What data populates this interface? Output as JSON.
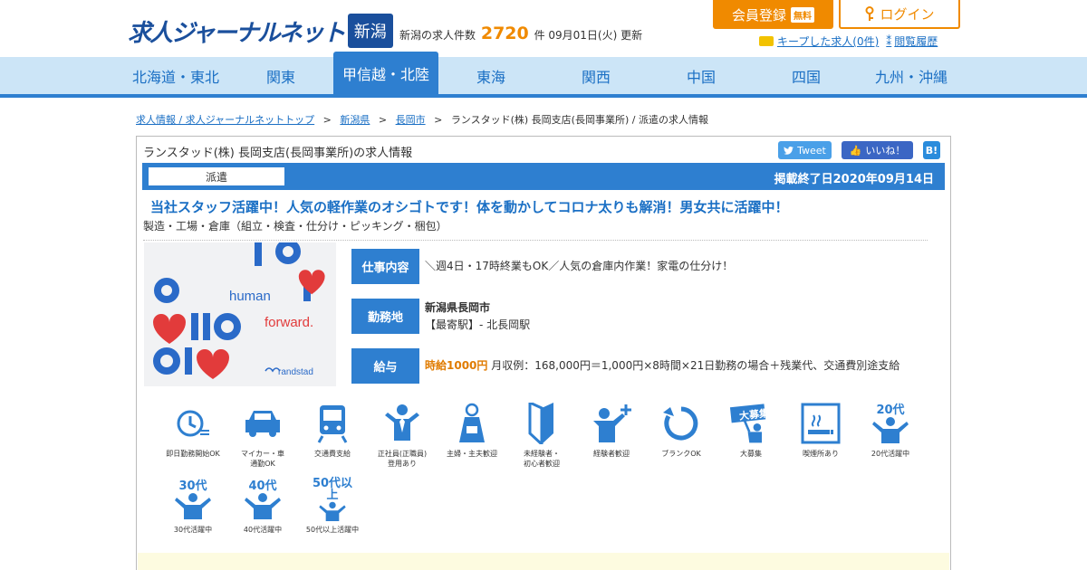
{
  "header": {
    "logo_text": "求人ジャーナルネット",
    "region_badge": "新潟",
    "count_prefix": "新潟の求人件数",
    "count_value": "2720",
    "count_suffix": "件 09月01日(火) 更新",
    "register_label": "会員登録",
    "register_badge": "無料",
    "login_label": "ログイン",
    "kept_jobs_label": "キープした求人(0件)",
    "history_label": "閲覧履歴"
  },
  "nav": {
    "items": [
      {
        "label": "北海道・東北"
      },
      {
        "label": "関東"
      },
      {
        "label": "甲信越・北陸"
      },
      {
        "label": "東海"
      },
      {
        "label": "関西"
      },
      {
        "label": "中国"
      },
      {
        "label": "四国"
      },
      {
        "label": "九州・沖縄"
      }
    ],
    "active": "甲信越・北陸"
  },
  "breadcrumb": {
    "items": [
      {
        "label": "求人情報 / 求人ジャーナルネットトップ"
      },
      {
        "label": "新潟県"
      },
      {
        "label": "長岡市"
      }
    ],
    "current": "ランスタッド(株) 長岡支店(長岡事業所) / 派遣の求人情報"
  },
  "job": {
    "card_title": "ランスタッド(株) 長岡支店(長岡事業所)の求人情報",
    "share": {
      "tweet": "Tweet",
      "like": "いいね！",
      "hatena": "B!"
    },
    "employment_type": "派遣",
    "end_date": "掲載終了日2020年09月14日",
    "headline": "当社スタッフ活躍中！人気の軽作業のオシゴトです！体を動かしてコロナ太りも解消！男女共に活躍中！",
    "category": "製造・工場・倉庫（組立・検査・仕分け・ピッキング・梱包）",
    "photo": {
      "brand": "randstad",
      "text1": "human",
      "text2": "forward."
    },
    "details": {
      "work_label": "仕事内容",
      "work_text": "＼週4日・17時終業もOK／人気の倉庫内作業！家電の仕分け！",
      "location_label": "勤務地",
      "location_main": "新潟県長岡市",
      "location_station": "【最寄駅】- 北長岡駅",
      "salary_label": "給与",
      "salary_highlight": "時給1000円",
      "salary_text": "月収例：168,000円＝1,000円×8時間×21日勤務の場合＋残業代、交通費別途支給"
    },
    "features": [
      {
        "icon": "clock-icon",
        "label": "即日勤務開始OK"
      },
      {
        "icon": "car-icon",
        "label": "マイカー・車\n通勤OK"
      },
      {
        "icon": "train-icon",
        "label": "交通費支給"
      },
      {
        "icon": "employee-icon",
        "label": "正社員(正職員)\n登用あり"
      },
      {
        "icon": "apron-icon",
        "label": "主婦・主夫歓迎"
      },
      {
        "icon": "beginner-mark-icon",
        "label": "未経験者・\n初心者歓迎"
      },
      {
        "icon": "experienced-icon",
        "label": "経験者歓迎"
      },
      {
        "icon": "blank-ok-icon",
        "label": "ブランクOK"
      },
      {
        "icon": "mass-hiring-icon",
        "label": "大募集",
        "tag": "大募集"
      },
      {
        "icon": "smoking-area-icon",
        "label": "喫煙所あり"
      },
      {
        "icon": "age-20s-icon",
        "label": "20代活躍中",
        "tag": "20代"
      },
      {
        "icon": "age-30s-icon",
        "label": "30代活躍中",
        "tag": "30代"
      },
      {
        "icon": "age-40s-icon",
        "label": "40代活躍中",
        "tag": "40代"
      },
      {
        "icon": "age-50s-icon",
        "label": "50代以上活躍中",
        "tag": "50代以上"
      }
    ]
  },
  "colors": {
    "accent": "#2e7fd0",
    "brand": "#1a4f9c",
    "orange": "#f08a00",
    "nav_bg": "#cce5f7"
  }
}
